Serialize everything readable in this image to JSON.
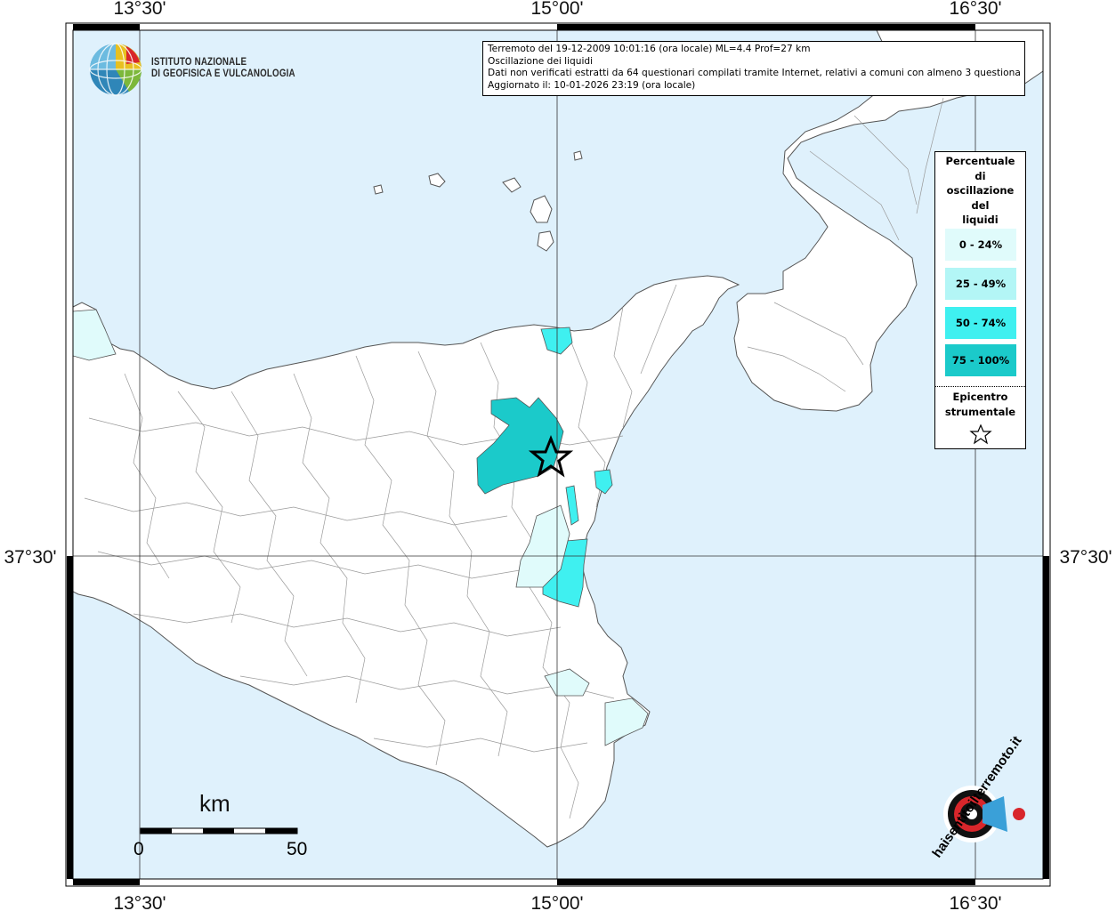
{
  "map": {
    "longitude_ticks": [
      "13°30'",
      "15°00'",
      "16°30'"
    ],
    "latitude_ticks": [
      "37°30'"
    ],
    "epicenter_marker": "star-icon",
    "colors": {
      "sea": "#dff1fc",
      "land": "#ffffff",
      "border": "#888888",
      "class_0_24": "#e0fbfb",
      "class_25_49": "#b3f6f6",
      "class_50_74": "#3ff0f0",
      "class_75_100": "#1bcaca"
    }
  },
  "info": {
    "line1": "Terremoto del 19-12-2009 10:01:16 (ora locale) ML=4.4 Prof=27 km",
    "line2": "Oscillazione dei liquidi",
    "line3": "Dati non verificati estratti da 64 questionari compilati tramite Internet, relativi a comuni con almeno 3 questionari.",
    "line4": "Aggiornato il: 10-01-2026 23:19 (ora locale)"
  },
  "legend": {
    "title_lines": [
      "Percentuale",
      "di",
      "oscillazione",
      "del",
      "liquidi"
    ],
    "classes": [
      "0 - 24%",
      "25 - 49%",
      "50 - 74%",
      "75 - 100%"
    ],
    "epicenter_lines": [
      "Epicentro",
      "strumentale"
    ]
  },
  "logo": {
    "line1": "ISTITUTO NAZIONALE",
    "line2": "DI GEOFISICA E VULCANOLOGIA",
    "icon": "globe-icon"
  },
  "scalebar": {
    "title": "km",
    "start": "0",
    "end": "50"
  },
  "badge": {
    "text": "haisentitoilterremoto.it",
    "icon": "target-icon"
  }
}
